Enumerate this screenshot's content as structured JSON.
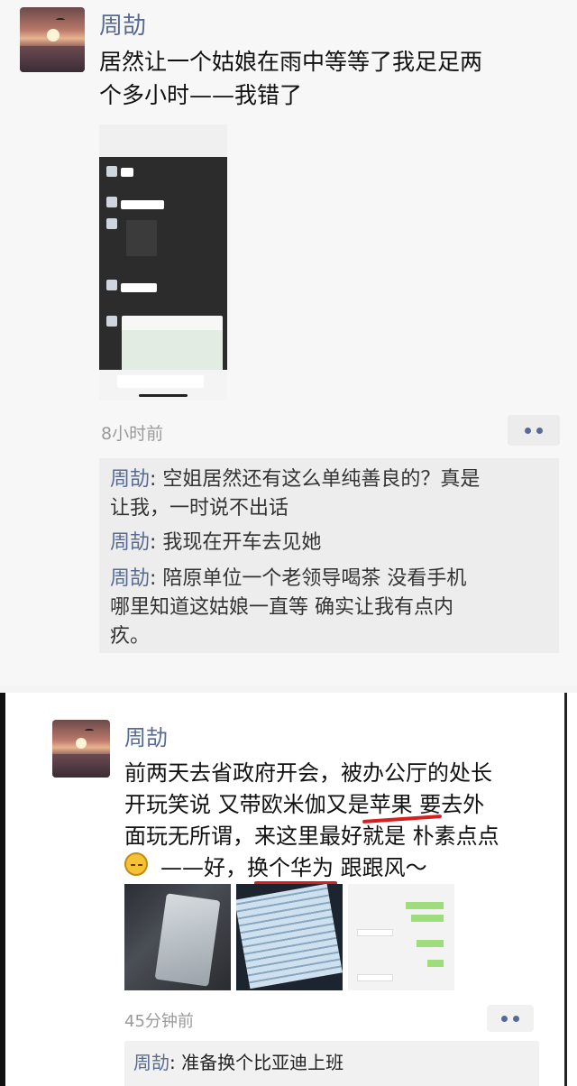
{
  "post1": {
    "author": "周劼",
    "text_line1": "居然让一个姑娘在雨中等等了我足足两",
    "text_line2": "个多小时——我错了",
    "time": "8小时前",
    "comments": [
      {
        "name": "周劼",
        "line1": ": 空姐居然还有这么单纯善良的？真是",
        "line2": "让我，一时说不出话"
      },
      {
        "name": "周劼",
        "line1": ": 我现在开车去见她"
      },
      {
        "name": "周劼",
        "line1": ": 陪原单位一个老领导喝茶  没看手机",
        "line2": "哪里知道这姑娘一直等    确实让我有点内",
        "line3": "疚。"
      }
    ]
  },
  "post2": {
    "author": "周劼",
    "line1": "前两天去省政府开会，被办公厅的处长",
    "line2": "开玩笑说 又带欧米伽又是苹果  要去外",
    "line3": "面玩无所谓，来这里最好就是 朴素点点",
    "line4": "——好，换个华为 跟跟风～",
    "time": "45分钟前",
    "comment": {
      "name": "周劼",
      "text": ": 准备换个比亚迪上班"
    }
  },
  "colors": {
    "name_blue": "#576b95",
    "underline_red": "#d42020"
  },
  "icons": [
    "more-dots-icon",
    "laughing-emoji-icon"
  ]
}
